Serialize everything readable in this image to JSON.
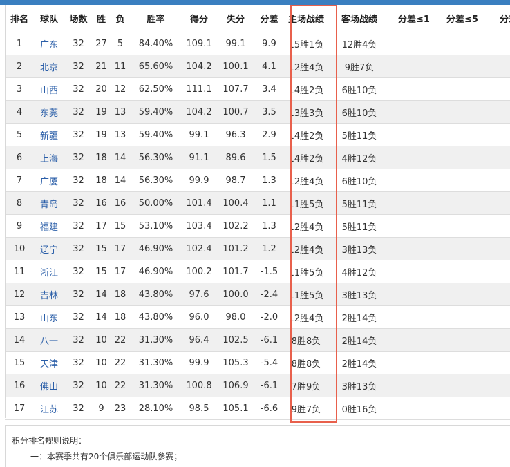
{
  "header_strip": {
    "label": ""
  },
  "columns": [
    "排名",
    "球队",
    "场数",
    "胜",
    "负",
    "胜率",
    "得分",
    "失分",
    "分差",
    "主场战绩",
    "客场战绩",
    "分差≤1",
    "分差≤5",
    "分差"
  ],
  "rows": [
    {
      "rank": "1",
      "team": "广东",
      "games": "32",
      "wins": "27",
      "losses": "5",
      "pct": "84.40%",
      "pf": "109.1",
      "pa": "99.1",
      "diff": "9.9",
      "home": "15胜1负",
      "away": "12胜4负"
    },
    {
      "rank": "2",
      "team": "北京",
      "games": "32",
      "wins": "21",
      "losses": "11",
      "pct": "65.60%",
      "pf": "104.2",
      "pa": "100.1",
      "diff": "4.1",
      "home": "12胜4负",
      "away": "9胜7负"
    },
    {
      "rank": "3",
      "team": "山西",
      "games": "32",
      "wins": "20",
      "losses": "12",
      "pct": "62.50%",
      "pf": "111.1",
      "pa": "107.7",
      "diff": "3.4",
      "home": "14胜2负",
      "away": "6胜10负"
    },
    {
      "rank": "4",
      "team": "东莞",
      "games": "32",
      "wins": "19",
      "losses": "13",
      "pct": "59.40%",
      "pf": "104.2",
      "pa": "100.7",
      "diff": "3.5",
      "home": "13胜3负",
      "away": "6胜10负"
    },
    {
      "rank": "5",
      "team": "新疆",
      "games": "32",
      "wins": "19",
      "losses": "13",
      "pct": "59.40%",
      "pf": "99.1",
      "pa": "96.3",
      "diff": "2.9",
      "home": "14胜2负",
      "away": "5胜11负"
    },
    {
      "rank": "6",
      "team": "上海",
      "games": "32",
      "wins": "18",
      "losses": "14",
      "pct": "56.30%",
      "pf": "91.1",
      "pa": "89.6",
      "diff": "1.5",
      "home": "14胜2负",
      "away": "4胜12负"
    },
    {
      "rank": "7",
      "team": "广厦",
      "games": "32",
      "wins": "18",
      "losses": "14",
      "pct": "56.30%",
      "pf": "99.9",
      "pa": "98.7",
      "diff": "1.3",
      "home": "12胜4负",
      "away": "6胜10负"
    },
    {
      "rank": "8",
      "team": "青岛",
      "games": "32",
      "wins": "16",
      "losses": "16",
      "pct": "50.00%",
      "pf": "101.4",
      "pa": "100.4",
      "diff": "1.1",
      "home": "11胜5负",
      "away": "5胜11负"
    },
    {
      "rank": "9",
      "team": "福建",
      "games": "32",
      "wins": "17",
      "losses": "15",
      "pct": "53.10%",
      "pf": "103.4",
      "pa": "102.2",
      "diff": "1.3",
      "home": "12胜4负",
      "away": "5胜11负"
    },
    {
      "rank": "10",
      "team": "辽宁",
      "games": "32",
      "wins": "15",
      "losses": "17",
      "pct": "46.90%",
      "pf": "102.4",
      "pa": "101.2",
      "diff": "1.2",
      "home": "12胜4负",
      "away": "3胜13负"
    },
    {
      "rank": "11",
      "team": "浙江",
      "games": "32",
      "wins": "15",
      "losses": "17",
      "pct": "46.90%",
      "pf": "100.2",
      "pa": "101.7",
      "diff": "-1.5",
      "home": "11胜5负",
      "away": "4胜12负"
    },
    {
      "rank": "12",
      "team": "吉林",
      "games": "32",
      "wins": "14",
      "losses": "18",
      "pct": "43.80%",
      "pf": "97.6",
      "pa": "100.0",
      "diff": "-2.4",
      "home": "11胜5负",
      "away": "3胜13负"
    },
    {
      "rank": "13",
      "team": "山东",
      "games": "32",
      "wins": "14",
      "losses": "18",
      "pct": "43.80%",
      "pf": "96.0",
      "pa": "98.0",
      "diff": "-2.0",
      "home": "12胜4负",
      "away": "2胜14负"
    },
    {
      "rank": "14",
      "team": "八一",
      "games": "32",
      "wins": "10",
      "losses": "22",
      "pct": "31.30%",
      "pf": "96.4",
      "pa": "102.5",
      "diff": "-6.1",
      "home": "8胜8负",
      "away": "2胜14负"
    },
    {
      "rank": "15",
      "team": "天津",
      "games": "32",
      "wins": "10",
      "losses": "22",
      "pct": "31.30%",
      "pf": "99.9",
      "pa": "105.3",
      "diff": "-5.4",
      "home": "8胜8负",
      "away": "2胜14负"
    },
    {
      "rank": "16",
      "team": "佛山",
      "games": "32",
      "wins": "10",
      "losses": "22",
      "pct": "31.30%",
      "pf": "100.8",
      "pa": "106.9",
      "diff": "-6.1",
      "home": "7胜9负",
      "away": "3胜13负"
    },
    {
      "rank": "17",
      "team": "江苏",
      "games": "32",
      "wins": "9",
      "losses": "23",
      "pct": "28.10%",
      "pf": "98.5",
      "pa": "105.1",
      "diff": "-6.6",
      "home": "9胜7负",
      "away": "0胜16负"
    }
  ],
  "rules": {
    "title": "积分排名规则说明：",
    "line1": "一：本赛季共有20个俱乐部运动队参赛；"
  },
  "colors": {
    "header_strip": "#3a7fc0",
    "team_link": "#2a5ea8",
    "highlight_border": "#e8604c",
    "even_row": "#f0f0f0"
  }
}
